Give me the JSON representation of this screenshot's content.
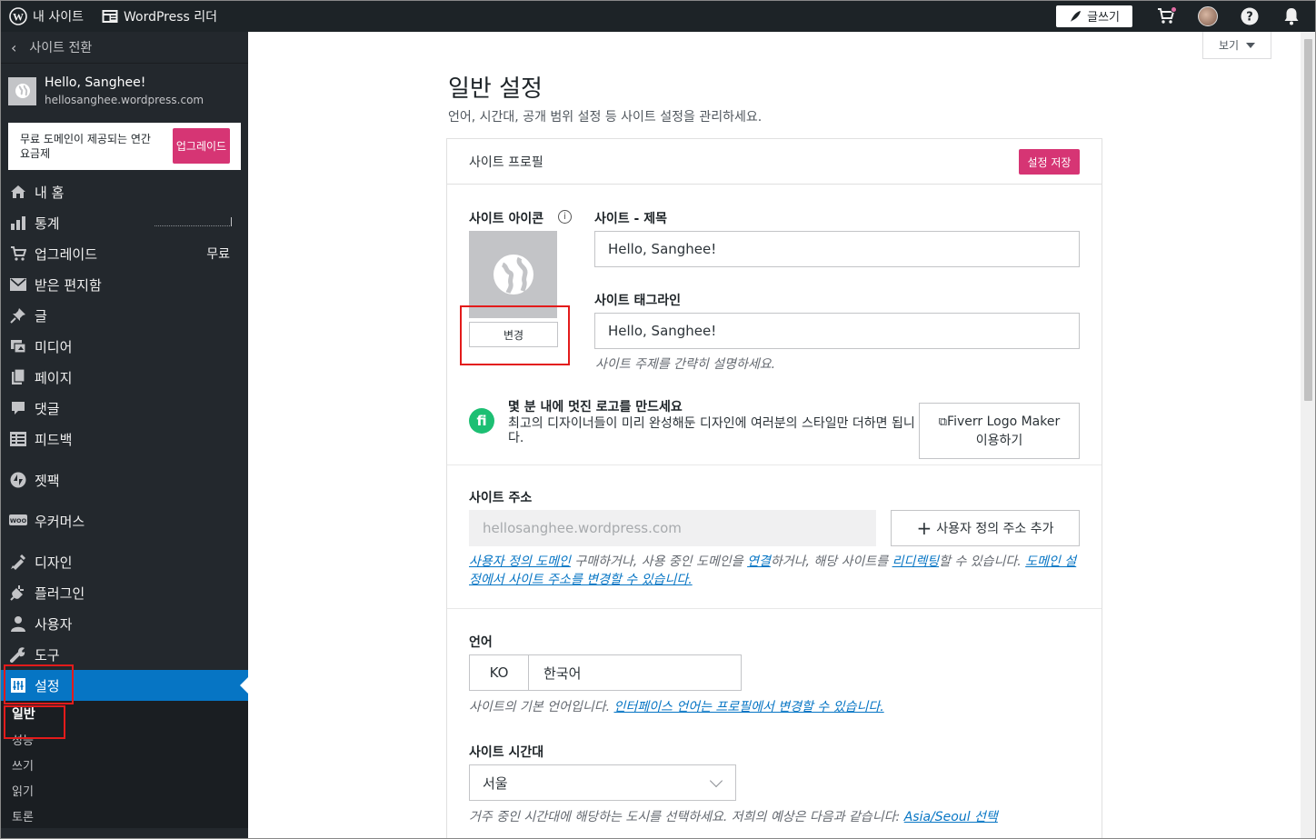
{
  "topbar": {
    "my_site": "내 사이트",
    "reader": "WordPress 리더",
    "write": "글쓰기"
  },
  "sidebar": {
    "switch_site": "사이트 전환",
    "site_name": "Hello, Sanghee!",
    "site_url": "hellosanghee.wordpress.com",
    "promo_text": "무료 도메인이 제공되는 연간 요금제",
    "promo_button": "업그레이드",
    "items": [
      {
        "label": "내 홈",
        "icon": "home-icon"
      },
      {
        "label": "통계",
        "icon": "stats-icon"
      },
      {
        "label": "업그레이드",
        "icon": "cart-icon",
        "aside": "무료"
      },
      {
        "label": "받은 편지함",
        "icon": "mail-icon"
      },
      {
        "label": "글",
        "icon": "pin-icon"
      },
      {
        "label": "미디어",
        "icon": "media-icon"
      },
      {
        "label": "페이지",
        "icon": "page-icon"
      },
      {
        "label": "댓글",
        "icon": "comment-icon"
      },
      {
        "label": "피드백",
        "icon": "feedback-icon"
      },
      {
        "label": "젯팩",
        "icon": "jetpack-icon"
      },
      {
        "label": "우커머스",
        "icon": "woo-icon"
      },
      {
        "label": "디자인",
        "icon": "design-icon"
      },
      {
        "label": "플러그인",
        "icon": "plugin-icon"
      },
      {
        "label": "사용자",
        "icon": "user-icon"
      },
      {
        "label": "도구",
        "icon": "wrench-icon"
      },
      {
        "label": "설정",
        "icon": "settings-icon"
      }
    ],
    "sub_items": [
      "일반",
      "성능",
      "쓰기",
      "읽기",
      "토론"
    ]
  },
  "main": {
    "view_button": "보기",
    "title": "일반 설정",
    "subtitle": "언어, 시간대, 공개 범위 설정 등 사이트 설정을 관리하세요.",
    "card_title": "사이트 프로필",
    "save_button": "설정 저장",
    "site_icon_label": "사이트 아이콘",
    "change_button": "변경",
    "title_label": "사이트 - 제목",
    "title_value": "Hello, Sanghee!",
    "tagline_label": "사이트 태그라인",
    "tagline_value": "Hello, Sanghee!",
    "tagline_help": "사이트 주제를 간략히 설명하세요.",
    "fiverr_title": "몇 분 내에 멋진 로고를 만드세요",
    "fiverr_desc": "최고의 디자이너들이 미리 완성해둔 디자인에 여러분의 스타일만 더하면 됩니다.",
    "fiverr_button_1": "Fiverr Logo Maker",
    "fiverr_button_2": "이용하기",
    "address_label": "사이트 주소",
    "address_value": "hellosanghee.wordpress.com",
    "address_button": "사용자 정의 주소 추가",
    "address_help": {
      "link1": "사용자 정의 도메인",
      "t1": " 구매하거나, 사용 중인 도메인을 ",
      "link2": "연결",
      "t2": "하거나, 해당 사이트를 ",
      "link3": "리디렉팅",
      "t3": "할 수 있습니다. ",
      "link4": "도메인 설정에서 사이트 주소를 변경할 수 있습니다."
    },
    "language_label": "언어",
    "language_code": "KO",
    "language_name": "한국어",
    "language_help": "사이트의 기본 언어입니다. ",
    "language_help_link": "인터페이스 언어는 프로필에서 변경할 수 있습니다.",
    "timezone_label": "사이트 시간대",
    "timezone_value": "서울",
    "timezone_help": "거주 중인 시간대에 해당하는 도시를 선택하세요. 저희의 예상은 다음과 같습니다: ",
    "timezone_help_link": "Asia/Seoul 선택"
  },
  "colors": {
    "accent": "#d63574",
    "sidebar_bg": "#23282d",
    "active": "#0675c4",
    "fiverr": "#1dbf73"
  }
}
